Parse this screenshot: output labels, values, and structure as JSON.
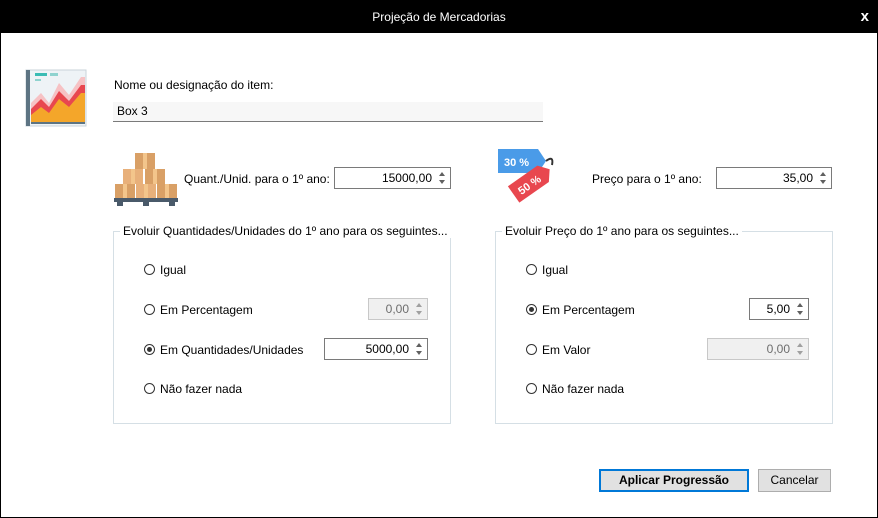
{
  "window": {
    "title": "Projeção de Mercadorias",
    "close_glyph": "x"
  },
  "item": {
    "label": "Nome ou designação do item:",
    "value": "Box 3"
  },
  "quantity": {
    "label": "Quant./Unid. para o 1º ano:",
    "value": "15000,00"
  },
  "price": {
    "label": "Preço para o 1º ano:",
    "value": "35,00",
    "tag_30": "30 %",
    "tag_50": "50 %"
  },
  "qty_group": {
    "title": "Evoluir Quantidades/Unidades do 1º ano para os seguintes...",
    "options": [
      {
        "label": "Igual",
        "checked": false
      },
      {
        "label": "Em Percentagem",
        "checked": false,
        "value": "0,00",
        "enabled": false
      },
      {
        "label": "Em Quantidades/Unidades",
        "checked": true,
        "value": "5000,00",
        "enabled": true
      },
      {
        "label": "Não fazer nada",
        "checked": false
      }
    ]
  },
  "price_group": {
    "title": "Evoluir Preço do 1º ano para os seguintes...",
    "options": [
      {
        "label": "Igual",
        "checked": false
      },
      {
        "label": "Em Percentagem",
        "checked": true,
        "value": "5,00",
        "enabled": true
      },
      {
        "label": "Em Valor",
        "checked": false,
        "value": "0,00",
        "enabled": false
      },
      {
        "label": "Não fazer nada",
        "checked": false
      }
    ]
  },
  "buttons": {
    "apply": "Aplicar Progressão",
    "cancel": "Cancelar"
  },
  "colors": {
    "titlebar": "#000000",
    "accent": "#0078d7",
    "tag_blue": "#4a9be8",
    "tag_red": "#e8474f",
    "chart_orange": "#f4a62a",
    "chart_red": "#e8474f"
  }
}
